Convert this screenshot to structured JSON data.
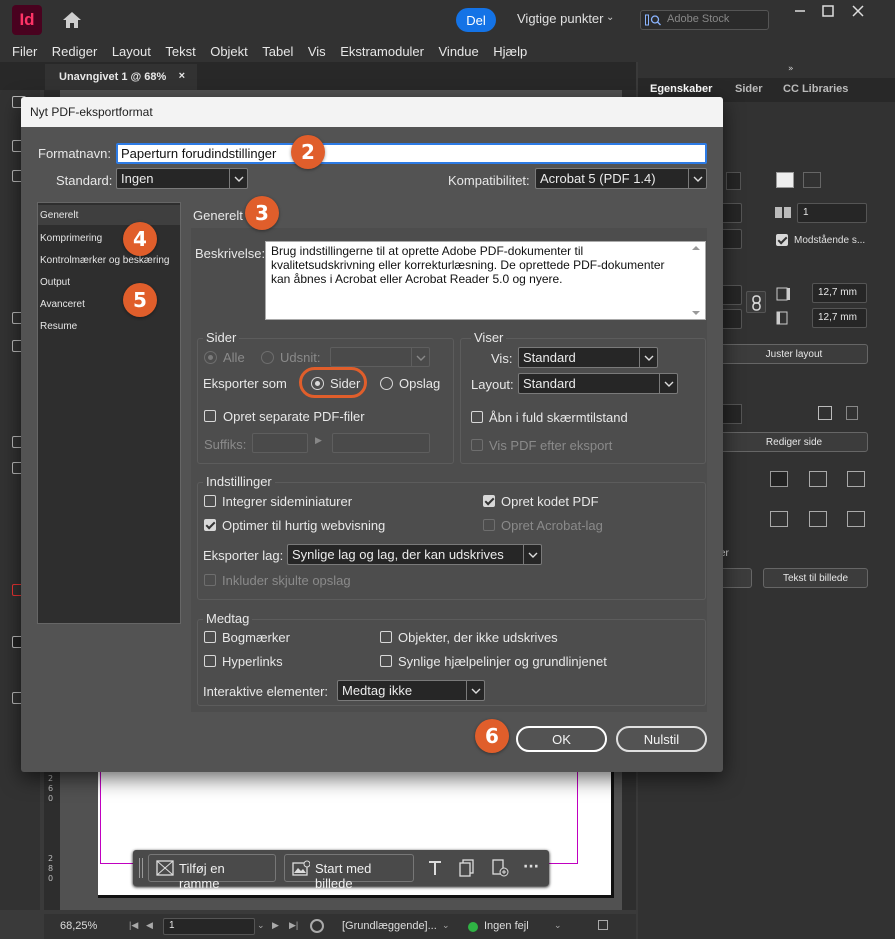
{
  "app": {
    "logo_text": "Id",
    "share_label": "Del",
    "workspace_label": "Vigtige punkter",
    "stock_search_placeholder": "Adobe Stock"
  },
  "menu": [
    "Filer",
    "Rediger",
    "Layout",
    "Tekst",
    "Objekt",
    "Tabel",
    "Vis",
    "Ekstramoduler",
    "Vindue",
    "Hjælp"
  ],
  "document_tab": {
    "title": "Unavngivet 1 @ 68%",
    "close": "×"
  },
  "right_panel": {
    "tabs": [
      "Egenskaber",
      "Sider",
      "CC Libraries"
    ],
    "page_count": "1",
    "facing_pages_label": "Modstående s...",
    "margin_right": "12,7 mm",
    "margin_bottom": "12,7 mm",
    "adjust_layout_label": "Juster layout",
    "edit_page_label": "Rediger side",
    "text_to_image_label": "Tekst til billede",
    "partial_label": "er"
  },
  "dialog": {
    "title": "Nyt PDF-eksportformat",
    "format_name_label": "Formatnavn:",
    "format_name_value": "Paperturn forudindstillinger",
    "standard_label": "Standard:",
    "standard_value": "Ingen",
    "compat_label": "Kompatibilitet:",
    "compat_value": "Acrobat 5 (PDF 1.4)",
    "sidebar": [
      "Generelt",
      "Komprimering",
      "Kontrolmærker og beskæring",
      "Output",
      "Avanceret",
      "Resume"
    ],
    "section_title": "Generelt",
    "description_label": "Beskrivelse:",
    "description_text": "Brug indstillingerne til at oprette Adobe PDF-dokumenter til kvalitetsudskrivning eller korrekturlæsning. De oprettede PDF-dokumenter kan åbnes i Acrobat eller Acrobat Reader 5.0 og nyere.",
    "pages": {
      "title": "Sider",
      "all_label": "Alle",
      "range_label": "Udsnit:",
      "export_as_label": "Eksporter som",
      "pages_option": "Sider",
      "spreads_option": "Opslag",
      "separate_files_label": "Opret separate PDF-filer",
      "suffix_label": "Suffiks:"
    },
    "view": {
      "title": "Viser",
      "view_label": "Vis:",
      "view_value": "Standard",
      "layout_label": "Layout:",
      "layout_value": "Standard",
      "fullscreen_label": "Åbn i fuld skærmtilstand",
      "view_after_label": "Vis PDF efter eksport"
    },
    "options": {
      "title": "Indstillinger",
      "embed_thumbs": "Integrer sideminiaturer",
      "optimize_web": "Optimer til hurtig webvisning",
      "tagged_pdf": "Opret kodet PDF",
      "acrobat_layers": "Opret Acrobat-lag",
      "export_layers_label": "Eksporter lag:",
      "export_layers_value": "Synlige lag og lag, der kan udskrives",
      "include_hidden": "Inkluder skjulte opslag"
    },
    "include": {
      "title": "Medtag",
      "bookmarks": "Bogmærker",
      "hyperlinks": "Hyperlinks",
      "non_printing": "Objekter, der ikke udskrives",
      "guides": "Synlige hjælpelinjer og grundlinjenet",
      "interactive_label": "Interaktive elementer:",
      "interactive_value": "Medtag ikke"
    },
    "ok_label": "OK",
    "reset_label": "Nulstil"
  },
  "markers": [
    "2",
    "3",
    "4",
    "5",
    "6"
  ],
  "context_bar": {
    "add_frame": "Tilføj en ramme",
    "start_image": "Start med billede"
  },
  "status": {
    "zoom": "68,25%",
    "page": "1",
    "preflight_profile": "[Grundlæggende]...",
    "errors": "Ingen fejl"
  },
  "ruler_marks": [
    "2",
    "6",
    "0",
    "2",
    "8",
    "0"
  ],
  "colors": {
    "accent": "#1473e6",
    "marker": "#e05e2b",
    "logo_bg": "#49021f",
    "logo_fg": "#ff3366",
    "ok_status": "#2fb344"
  }
}
